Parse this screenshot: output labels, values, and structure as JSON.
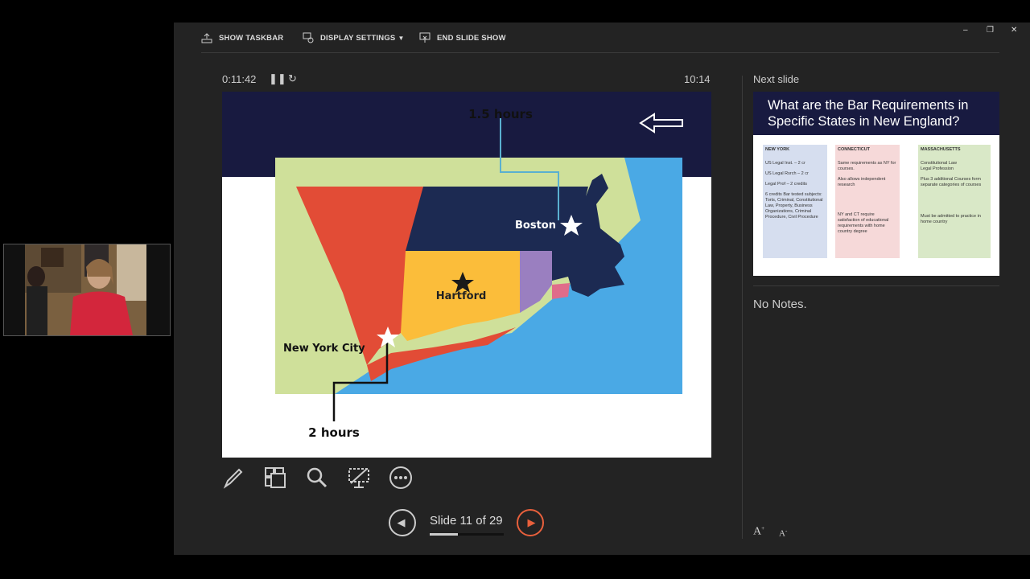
{
  "toolbar": {
    "show_taskbar": "SHOW TASKBAR",
    "display_settings": "DISPLAY SETTINGS",
    "end_slide_show": "END SLIDE SHOW"
  },
  "window_controls": {
    "minimize": "–",
    "restore": "❐",
    "close": "✕"
  },
  "timer": {
    "elapsed": "0:11:42",
    "clock": "10:14"
  },
  "current_slide": {
    "top_label": "1.5 hours",
    "bottom_label": "2 hours",
    "cities": {
      "boston": "Boston",
      "hartford": "Hartford",
      "nyc": "New York City"
    }
  },
  "next_slide": {
    "label": "Next slide",
    "title": "What are the Bar Requirements in Specific States in New England?",
    "columns": [
      {
        "heading": "NEW YORK",
        "lines": [
          "US Legal Inst. – 2 cr",
          "US Legal Rsrch – 2 cr",
          "Legal Prof – 2 credits",
          "6 credits Bar tested subjects: Torts, Criminal, Constitutional Law, Property, Business Organizations, Criminal Procedure, Civil Procedure"
        ]
      },
      {
        "heading": "CONNECTICUT",
        "lines": [
          "Same requirements as NY for courses.",
          "Also allows independent research",
          "NY and CT require satisfaction of educational requirements with home country degree"
        ]
      },
      {
        "heading": "MASSACHUSETTS",
        "lines": [
          "Constitutional Law",
          "Legal Profession",
          "Plus 3 additional Courses form separate categories of courses",
          "Must be admitted to practice in home country"
        ]
      }
    ]
  },
  "notes": {
    "text": "No Notes."
  },
  "navigation": {
    "counter": "Slide 11 of 29",
    "progress": 0.38
  },
  "colors": {
    "band": "#181a40",
    "next_arrow": "#e8603c",
    "ny": "#e24c36",
    "ct": "#fbbd3a",
    "ri": "#9a7fc0",
    "ma": "#1c2a52",
    "water": "#4aa9e5",
    "land": "#cfe09a"
  }
}
